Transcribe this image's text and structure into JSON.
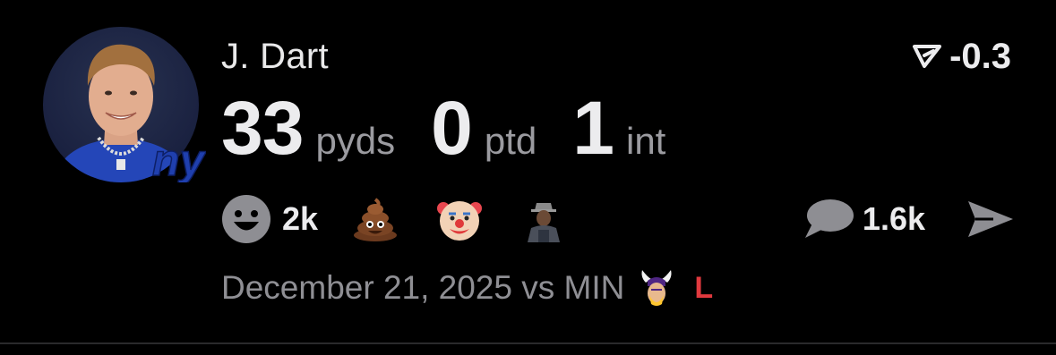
{
  "player": {
    "name": "J. Dart",
    "avatar_icon": "player-headshot",
    "team_logo_text": "ny",
    "team_color": "#1f3fae"
  },
  "rating": {
    "icon": "rating-triangle-icon",
    "value": "-0.3"
  },
  "stats": [
    {
      "value": "33",
      "label": "pyds"
    },
    {
      "value": "0",
      "label": "ptd"
    },
    {
      "value": "1",
      "label": "int"
    }
  ],
  "reactions": {
    "main_icon": "smiley-icon",
    "count": "2k",
    "emojis": [
      "poop-emoji",
      "clown-emoji",
      "meme-sticker"
    ]
  },
  "comments": {
    "icon": "speech-bubble-icon",
    "count": "1.6k"
  },
  "share": {
    "icon": "send-arrow-icon"
  },
  "game": {
    "date_text": "December 21, 2025 vs MIN",
    "opponent_logo": "vikings-logo",
    "result": "L",
    "result_color": "#e0393e"
  },
  "colors": {
    "background": "#000000",
    "primary_text": "#ececee",
    "secondary_text": "#9b9ba0",
    "icon_gray": "#8e8e93"
  }
}
